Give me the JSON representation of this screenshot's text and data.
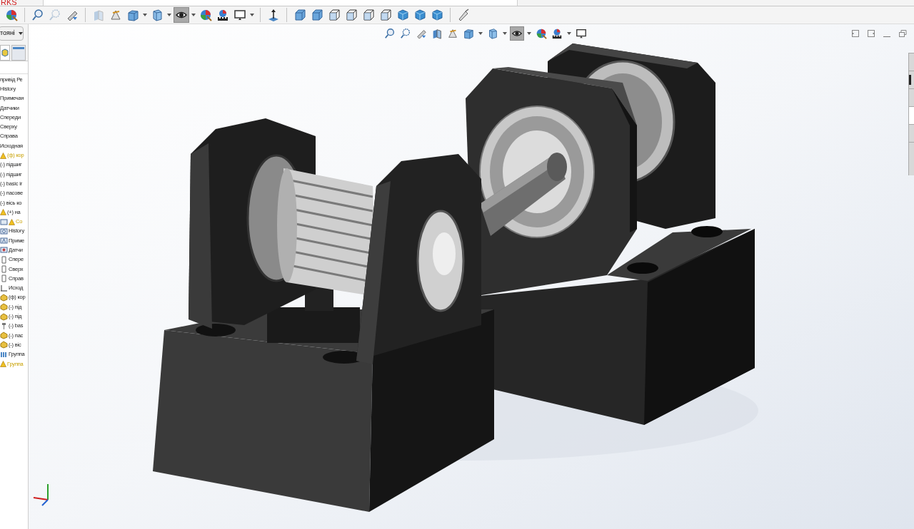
{
  "title_bar": {
    "logo_text": "RKS"
  },
  "toolbar": [
    {
      "kind": "appearance",
      "selected": false,
      "disabled": false,
      "menu": false,
      "group_end": true
    },
    {
      "kind": "zoom",
      "selected": false,
      "disabled": false,
      "menu": false,
      "group_end": false
    },
    {
      "kind": "zoom-area",
      "selected": false,
      "disabled": true,
      "menu": false,
      "group_end": false
    },
    {
      "kind": "previous",
      "selected": false,
      "disabled": false,
      "menu": false,
      "group_end": true
    },
    {
      "kind": "section",
      "selected": false,
      "disabled": true,
      "menu": false,
      "group_end": false
    },
    {
      "kind": "annotation",
      "selected": false,
      "disabled": false,
      "menu": false,
      "group_end": false
    },
    {
      "kind": "orientation",
      "selected": false,
      "disabled": false,
      "menu": true,
      "group_end": false
    },
    {
      "kind": "box",
      "selected": false,
      "disabled": false,
      "menu": true,
      "group_end": false
    },
    {
      "kind": "eye",
      "selected": true,
      "disabled": false,
      "menu": true,
      "group_end": false
    },
    {
      "kind": "appearance",
      "selected": false,
      "disabled": false,
      "menu": false,
      "group_end": false
    },
    {
      "kind": "scene",
      "selected": false,
      "disabled": false,
      "menu": false,
      "group_end": false
    },
    {
      "kind": "monitor",
      "selected": false,
      "disabled": false,
      "menu": true,
      "group_end": true
    },
    {
      "kind": "normal",
      "selected": false,
      "disabled": false,
      "menu": false,
      "group_end": true
    },
    {
      "kind": "view-cube",
      "selected": false,
      "disabled": false,
      "menu": false,
      "group_end": false
    },
    {
      "kind": "view-cube",
      "selected": false,
      "disabled": false,
      "menu": false,
      "group_end": false
    },
    {
      "kind": "wire-cube",
      "selected": false,
      "disabled": false,
      "menu": false,
      "group_end": false
    },
    {
      "kind": "wire-cube",
      "selected": false,
      "disabled": false,
      "menu": false,
      "group_end": false
    },
    {
      "kind": "wire-cube",
      "selected": false,
      "disabled": false,
      "menu": false,
      "group_end": false
    },
    {
      "kind": "wire-cube",
      "selected": false,
      "disabled": false,
      "menu": false,
      "group_end": false
    },
    {
      "kind": "solid-cube",
      "selected": false,
      "disabled": false,
      "menu": false,
      "group_end": false
    },
    {
      "kind": "solid-cube",
      "selected": false,
      "disabled": false,
      "menu": false,
      "group_end": false
    },
    {
      "kind": "solid-cube",
      "selected": false,
      "disabled": false,
      "menu": false,
      "group_end": true
    },
    {
      "kind": "probe",
      "selected": false,
      "disabled": false,
      "menu": false,
      "group_end": false
    }
  ],
  "config_dropdown": {
    "value": "тояні"
  },
  "tree": [
    {
      "label": "привід Ре",
      "kind": "plain",
      "warning": false,
      "flagged": false
    },
    {
      "label": "History",
      "kind": "plain",
      "warning": false,
      "flagged": false
    },
    {
      "label": "Примечан",
      "kind": "plain",
      "warning": false,
      "flagged": false
    },
    {
      "label": "Датчики",
      "kind": "plain",
      "warning": false,
      "flagged": false
    },
    {
      "label": "Спереди",
      "kind": "plain",
      "warning": false,
      "flagged": false
    },
    {
      "label": "Сверху",
      "kind": "plain",
      "warning": false,
      "flagged": false
    },
    {
      "label": "Справа",
      "kind": "plain",
      "warning": false,
      "flagged": false
    },
    {
      "label": "Исходная",
      "kind": "plain",
      "warning": false,
      "flagged": false
    },
    {
      "label": "(ф) кор",
      "kind": "plain",
      "warning": true,
      "flagged": true
    },
    {
      "label": "(-) підшиг",
      "kind": "plain",
      "warning": false,
      "flagged": false
    },
    {
      "label": "(-) підшиг",
      "kind": "plain",
      "warning": false,
      "flagged": false
    },
    {
      "label": "(-) basic ir",
      "kind": "plain",
      "warning": false,
      "flagged": false
    },
    {
      "label": "(-) пасове",
      "kind": "plain",
      "warning": false,
      "flagged": false
    },
    {
      "label": "(-) вісь ко",
      "kind": "plain",
      "warning": false,
      "flagged": false
    },
    {
      "label": "(+) на",
      "kind": "plain",
      "warning": true,
      "flagged": false
    },
    {
      "label": "Co",
      "kind": "assembly",
      "warning": true,
      "flagged": true
    },
    {
      "label": "History",
      "kind": "history",
      "warning": false,
      "flagged": false
    },
    {
      "label": "Приме",
      "kind": "notes",
      "warning": false,
      "flagged": false
    },
    {
      "label": "Датчи",
      "kind": "sensor",
      "warning": false,
      "flagged": false
    },
    {
      "label": "Спере",
      "kind": "plane",
      "warning": false,
      "flagged": false
    },
    {
      "label": "Сверх",
      "kind": "plane",
      "warning": false,
      "flagged": false
    },
    {
      "label": "Справ",
      "kind": "plane",
      "warning": false,
      "flagged": false
    },
    {
      "label": "Исход",
      "kind": "origin",
      "warning": false,
      "flagged": false
    },
    {
      "label": "(ф) кор",
      "kind": "part",
      "warning": false,
      "flagged": false
    },
    {
      "label": "(-) під",
      "kind": "part",
      "warning": false,
      "flagged": false
    },
    {
      "label": "(-) під",
      "kind": "part",
      "warning": false,
      "flagged": false
    },
    {
      "label": "(-) bas",
      "kind": "bolt",
      "warning": false,
      "flagged": false
    },
    {
      "label": "(-) пас",
      "kind": "part",
      "warning": false,
      "flagged": false
    },
    {
      "label": "(-) віс",
      "kind": "part",
      "warning": false,
      "flagged": false
    },
    {
      "label": "Группа",
      "kind": "mates",
      "warning": false,
      "flagged": false
    },
    {
      "label": "Группа",
      "kind": "plain",
      "warning": true,
      "flagged": true
    }
  ],
  "heads_up_toolbar": [
    {
      "kind": "zoom",
      "selected": false,
      "menu": false
    },
    {
      "kind": "zoom-area",
      "selected": false,
      "menu": false
    },
    {
      "kind": "previous",
      "selected": false,
      "menu": false
    },
    {
      "kind": "section",
      "selected": false,
      "menu": false
    },
    {
      "kind": "annotation",
      "selected": false,
      "menu": false
    },
    {
      "kind": "orientation",
      "selected": false,
      "menu": true
    },
    {
      "kind": "box",
      "selected": false,
      "menu": true
    },
    {
      "kind": "eye",
      "selected": true,
      "menu": true
    },
    {
      "kind": "appearance",
      "selected": false,
      "menu": false
    },
    {
      "kind": "scene",
      "selected": false,
      "menu": true
    },
    {
      "kind": "monitor",
      "selected": false,
      "menu": false
    }
  ]
}
